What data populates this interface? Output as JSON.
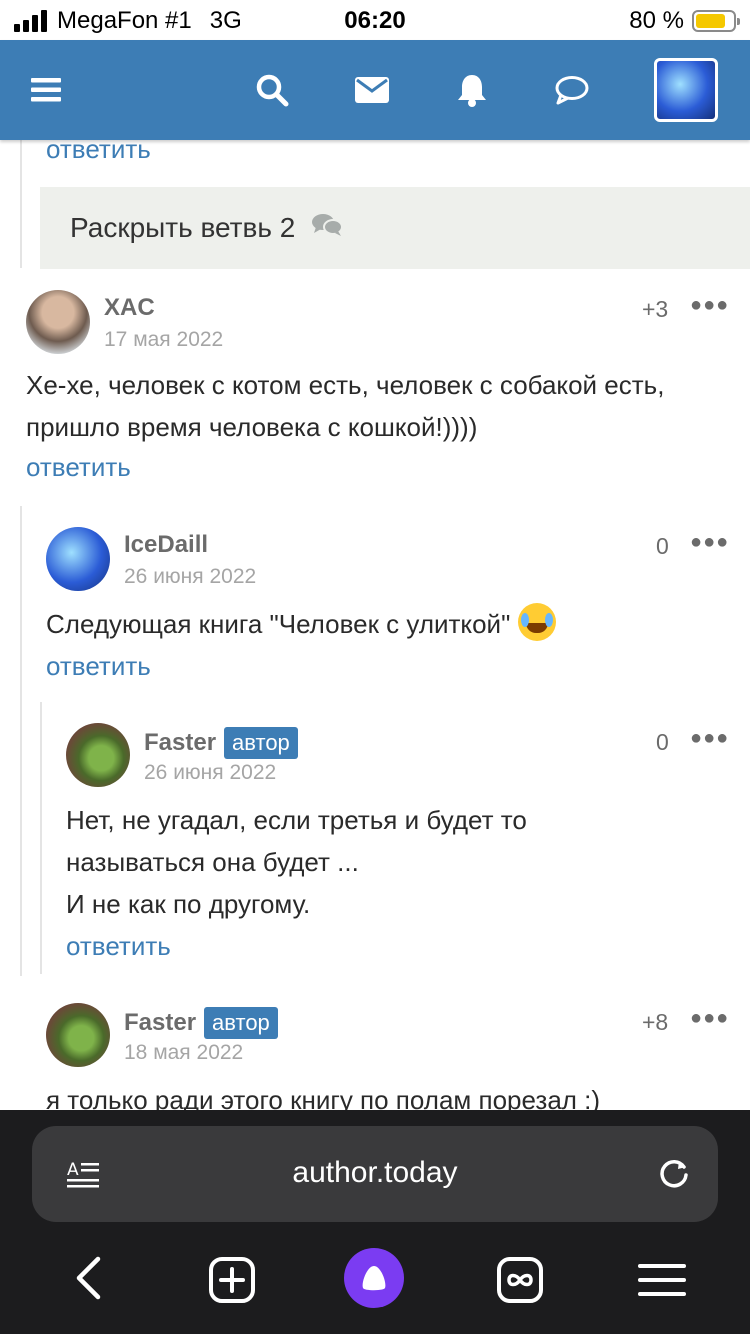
{
  "status_bar": {
    "carrier": "MegaFon #1",
    "network": "3G",
    "time": "06:20",
    "battery": "80 %",
    "battery_level": 0.8
  },
  "nav": {
    "icons": [
      "menu-icon",
      "search-icon",
      "mail-icon",
      "bell-icon",
      "chat-icon",
      "avatar"
    ]
  },
  "thread": {
    "top_reply": "ответить",
    "expand_label": "Раскрыть ветвь 2"
  },
  "comments": [
    {
      "author": "XAC",
      "date": "17 мая 2022",
      "score": "+3",
      "text": "Хе-хе, человек с котом есть, человек с собакой есть, пришло время человека с кошкой!))))",
      "reply": "ответить"
    },
    {
      "author": "IceDaill",
      "date": "26 июня 2022",
      "score": "0",
      "text": "Следующая книга \"Человек с улиткой\"",
      "reply": "ответить"
    },
    {
      "author": "Faster",
      "badge": "автор",
      "date": "26 июня 2022",
      "score": "0",
      "text_lines": [
        "Нет, не угадал, если третья и будет то",
        "называться она будет ...",
        "И не как по другому."
      ],
      "reply": "ответить"
    },
    {
      "author": "Faster",
      "badge": "автор",
      "date": "18 мая 2022",
      "score": "+8",
      "text": "я только ради этого книгу по полам порезал :)"
    }
  ],
  "browser": {
    "url": "author.today"
  },
  "colors": {
    "brand": "#3d7db5",
    "badge": "#3d7db5",
    "browser_bg": "#1c1c1e",
    "alice": "#7b3cf2"
  }
}
